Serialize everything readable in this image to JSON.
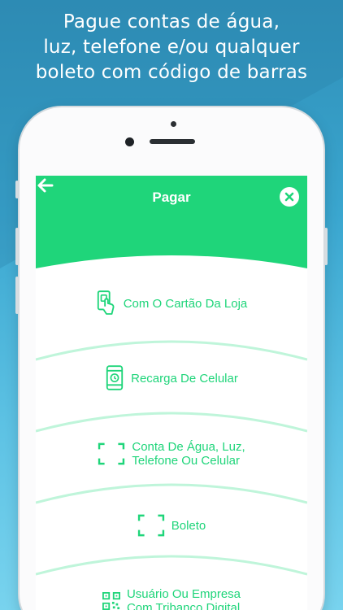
{
  "headline": {
    "line1": "Pague contas de água,",
    "line2": "luz, telefone e/ou qualquer",
    "line3": "boleto com código de barras"
  },
  "app": {
    "title": "Pagar",
    "back_icon": "arrow-left-icon",
    "close_icon": "close-icon",
    "brand_color": "#1fd57a"
  },
  "menu": {
    "items": [
      {
        "label": "Com O Cartão Da Loja",
        "icon": "card-tap-icon"
      },
      {
        "label": "Recarga De Celular",
        "icon": "phone-recharge-icon"
      },
      {
        "label_line1": "Conta De Água, Luz,",
        "label_line2": "Telefone Ou Celular",
        "icon": "barcode-scan-icon"
      },
      {
        "label": "Boleto",
        "icon": "barcode-scan-icon"
      },
      {
        "label_line1": "Usuário Ou Empresa",
        "label_line2": "Com Tribanco Digital",
        "icon": "qr-code-icon"
      }
    ]
  }
}
